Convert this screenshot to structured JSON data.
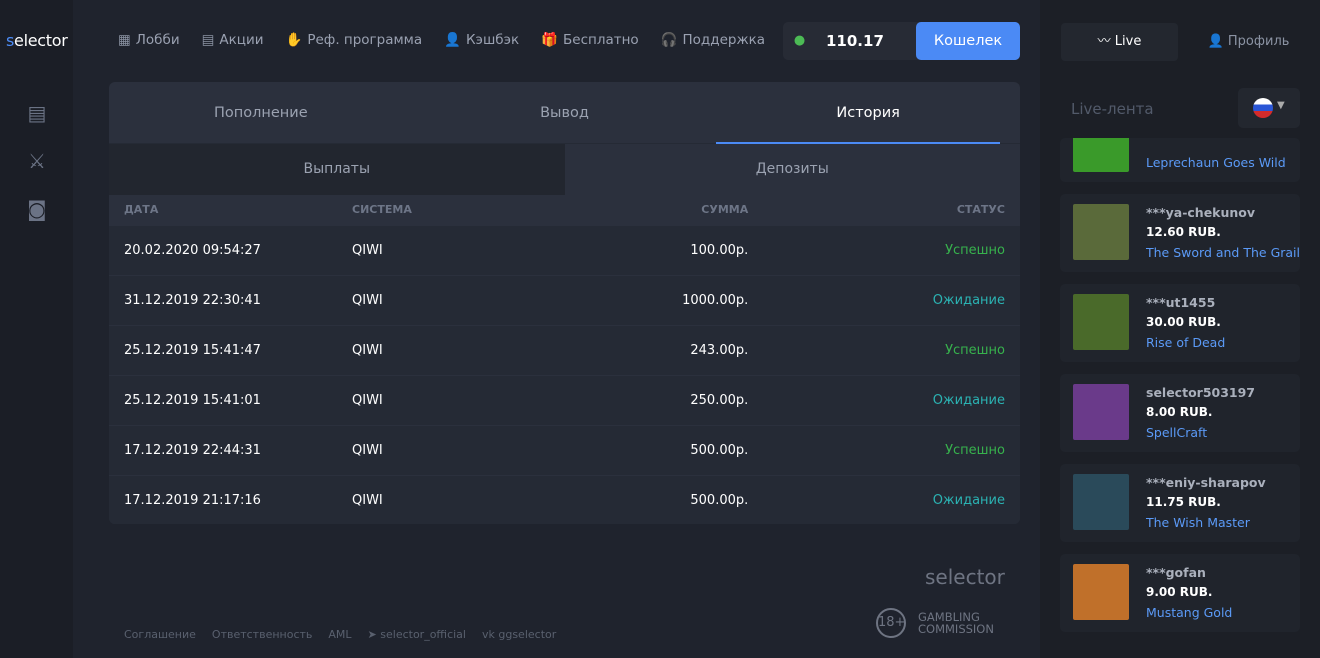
{
  "brand": {
    "logo_s": "s",
    "logo_rest": "elector"
  },
  "nav": [
    {
      "icon": "lobby-icon",
      "glyph": "▦",
      "label": "Лобби"
    },
    {
      "icon": "promo-icon",
      "glyph": "▤",
      "label": "Акции"
    },
    {
      "icon": "referral-icon",
      "glyph": "✋",
      "label": "Реф. программа"
    },
    {
      "icon": "user-icon",
      "glyph": "👤",
      "label": "Кэшбэк"
    },
    {
      "icon": "gift-icon",
      "glyph": "🎁",
      "label": "Бесплатно"
    },
    {
      "icon": "support-icon",
      "glyph": "🎧",
      "label": "Поддержка"
    }
  ],
  "balance": {
    "value": "110.17",
    "wallet_label": "Кошелек"
  },
  "tabs": [
    "Пополнение",
    "Вывод",
    "История"
  ],
  "subtabs": [
    "Выплаты",
    "Депозиты"
  ],
  "table": {
    "headers": [
      "ДАТА",
      "СИСТЕМА",
      "СУММА",
      "СТАТУС"
    ],
    "rows": [
      [
        "20.02.2020 09:54:27",
        "QIWI",
        "100.00р.",
        "Успешно"
      ],
      [
        "31.12.2019 22:30:41",
        "QIWI",
        "1000.00р.",
        "Ожидание"
      ],
      [
        "25.12.2019 15:41:47",
        "QIWI",
        "243.00р.",
        "Успешно"
      ],
      [
        "25.12.2019 15:41:01",
        "QIWI",
        "250.00р.",
        "Ожидание"
      ],
      [
        "17.12.2019 22:44:31",
        "QIWI",
        "500.00р.",
        "Успешно"
      ],
      [
        "17.12.2019 21:17:16",
        "QIWI",
        "500.00р.",
        "Ожидание"
      ]
    ]
  },
  "right": {
    "live_label": "Live",
    "profile_label": "Профиль",
    "feed_title": "Live-лента",
    "feed": [
      {
        "user": "",
        "amount": "",
        "game": "Leprechaun Goes Wild",
        "color": "#3a9a2a"
      },
      {
        "user": "***ya-chekunov",
        "amount": "12.60 RUB.",
        "game": "The Sword and The Grail",
        "color": "#5a6a3a"
      },
      {
        "user": "***ut1455",
        "amount": "30.00 RUB.",
        "game": "Rise of Dead",
        "color": "#4a6a2a"
      },
      {
        "user": "selector503197",
        "amount": "8.00 RUB.",
        "game": "SpellCraft",
        "color": "#6a3a8a"
      },
      {
        "user": "***eniy-sharapov",
        "amount": "11.75 RUB.",
        "game": "The Wish Master",
        "color": "#2a4a5a"
      },
      {
        "user": "***gofan",
        "amount": "9.00 RUB.",
        "game": "Mustang Gold",
        "color": "#c0702a"
      }
    ]
  },
  "footer": {
    "links": [
      "Соглашение",
      "Ответственность",
      "AML",
      "selector_official",
      "ggselector"
    ],
    "logo": "selector",
    "age": "18+",
    "gc": "GAMBLING",
    "gc2": "COMMISSION"
  }
}
